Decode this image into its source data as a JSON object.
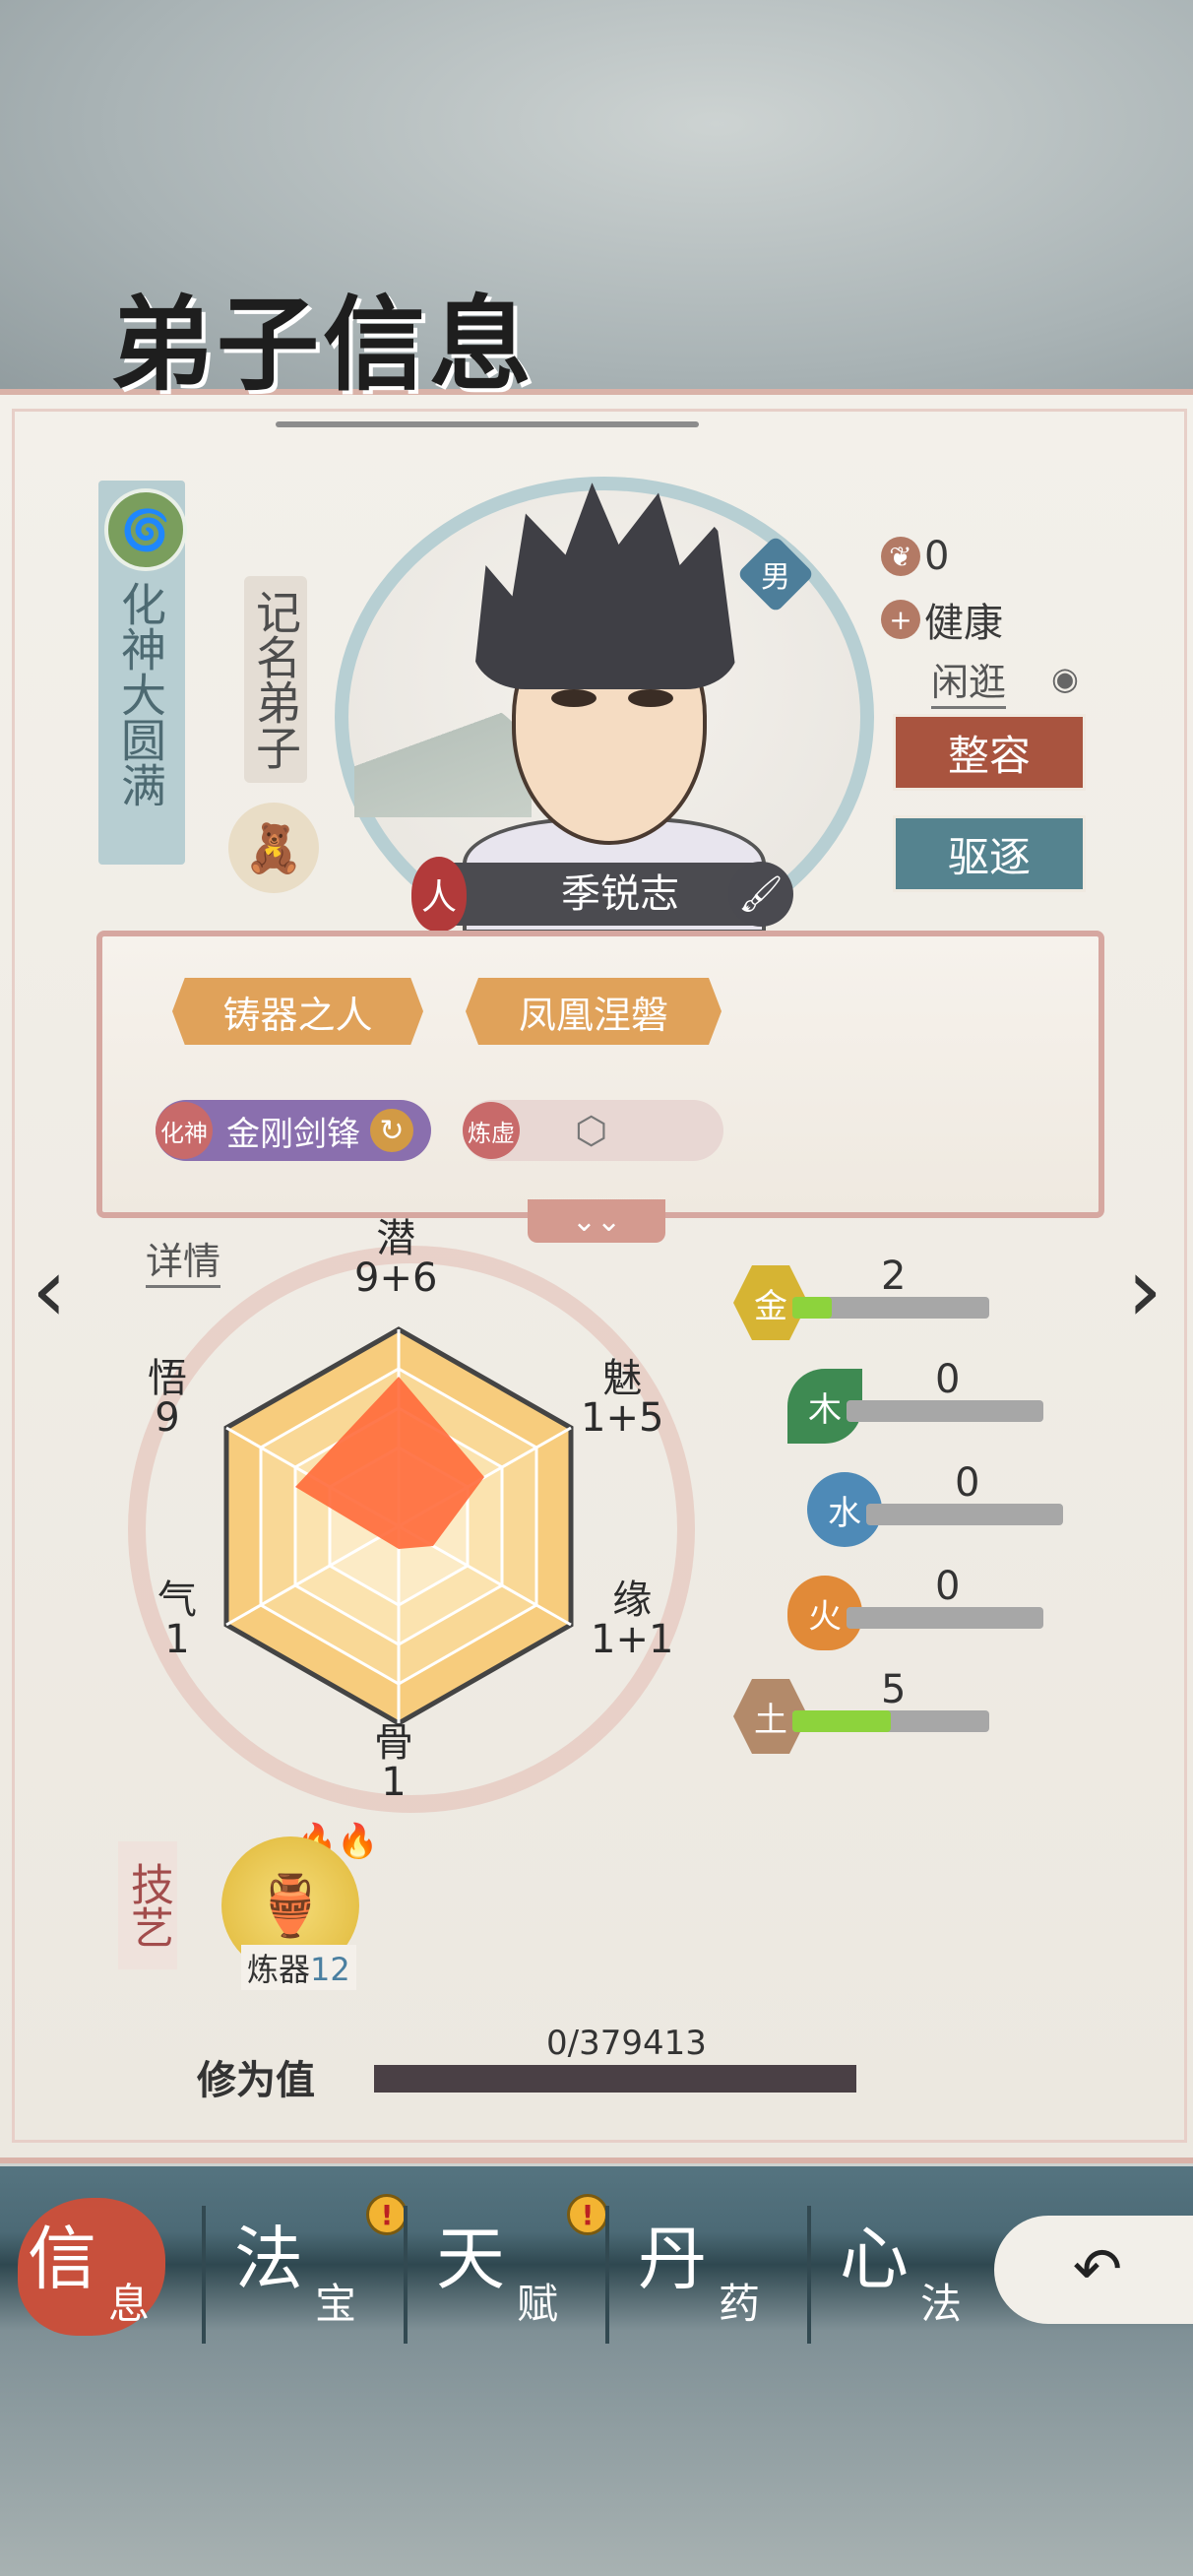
{
  "colors": {
    "accent_red": "#a9543f",
    "accent_teal": "#55838f",
    "bar_green": "#8dd33c"
  },
  "title": "弟子信息",
  "realm": "化神大圆满",
  "rank": "记名弟子",
  "disciple": {
    "name": "季锐志",
    "gender": "男",
    "race_badge": "人"
  },
  "status": {
    "value_count": "0",
    "health": "健康",
    "activity": "闲逛"
  },
  "buttons": {
    "makeover": "整容",
    "expel": "驱逐"
  },
  "traits": [
    "铸器之人",
    "凤凰涅磐"
  ],
  "skills": [
    {
      "tag": "化神",
      "name": "金刚剑锋"
    },
    {
      "tag": "炼虚",
      "name": ""
    }
  ],
  "detail_link": "详情",
  "attributes": [
    {
      "name": "潜",
      "value": "9+6"
    },
    {
      "name": "魅",
      "value": "1+5"
    },
    {
      "name": "缘",
      "value": "1+1"
    },
    {
      "name": "骨",
      "value": "1"
    },
    {
      "name": "气",
      "value": "1"
    },
    {
      "name": "悟",
      "value": "9"
    }
  ],
  "elements": [
    {
      "name": "金",
      "value": 2,
      "fill": 0.2,
      "icon": "metal-icon"
    },
    {
      "name": "木",
      "value": 0,
      "fill": 0,
      "icon": "wood-icon"
    },
    {
      "name": "水",
      "value": 0,
      "fill": 0,
      "icon": "water-icon"
    },
    {
      "name": "火",
      "value": 0,
      "fill": 0,
      "icon": "fire-icon"
    },
    {
      "name": "土",
      "value": 5,
      "fill": 0.5,
      "icon": "earth-icon"
    }
  ],
  "crafts": {
    "label": "技艺",
    "skill_name": "炼器",
    "level": "12"
  },
  "cultivation": {
    "label": "修为值",
    "value": "0/379413",
    "progress": 0
  },
  "tabs": [
    {
      "big": "信",
      "small": "息",
      "active": true,
      "alert": false
    },
    {
      "big": "法",
      "small": "宝",
      "active": false,
      "alert": true
    },
    {
      "big": "天",
      "small": "赋",
      "active": false,
      "alert": true
    },
    {
      "big": "丹",
      "small": "药",
      "active": false,
      "alert": false
    },
    {
      "big": "心",
      "small": "法",
      "active": false,
      "alert": false
    }
  ]
}
